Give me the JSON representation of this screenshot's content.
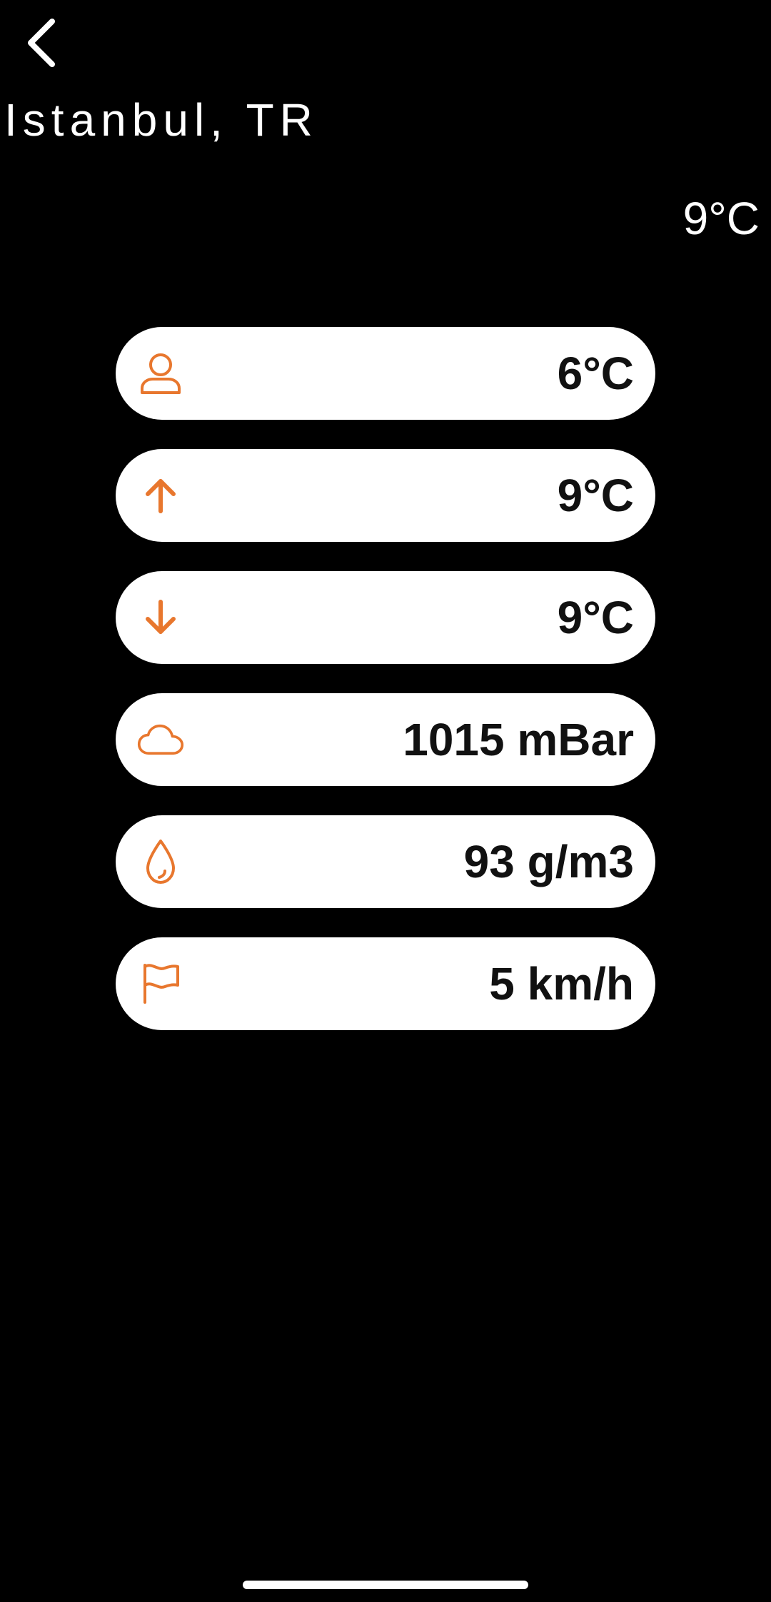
{
  "header": {
    "back_icon": "chevron-left-icon",
    "city": "Istanbul, TR",
    "current_temperature": "9°C"
  },
  "metrics": [
    {
      "icon": "person-icon",
      "label_name": "feels-like",
      "value": "6°C"
    },
    {
      "icon": "arrow-up-icon",
      "label_name": "max-temperature",
      "value": "9°C"
    },
    {
      "icon": "arrow-down-icon",
      "label_name": "min-temperature",
      "value": "9°C"
    },
    {
      "icon": "cloud-icon",
      "label_name": "pressure",
      "value": "1015 mBar"
    },
    {
      "icon": "droplet-icon",
      "label_name": "humidity",
      "value": "93 g/m3"
    },
    {
      "icon": "flag-icon",
      "label_name": "wind-speed",
      "value": "5 km/h"
    }
  ],
  "colors": {
    "background": "#000000",
    "accent": "#E8772E",
    "card": "#FFFFFF",
    "card_text": "#111111",
    "header_text": "#FFFFFF"
  }
}
